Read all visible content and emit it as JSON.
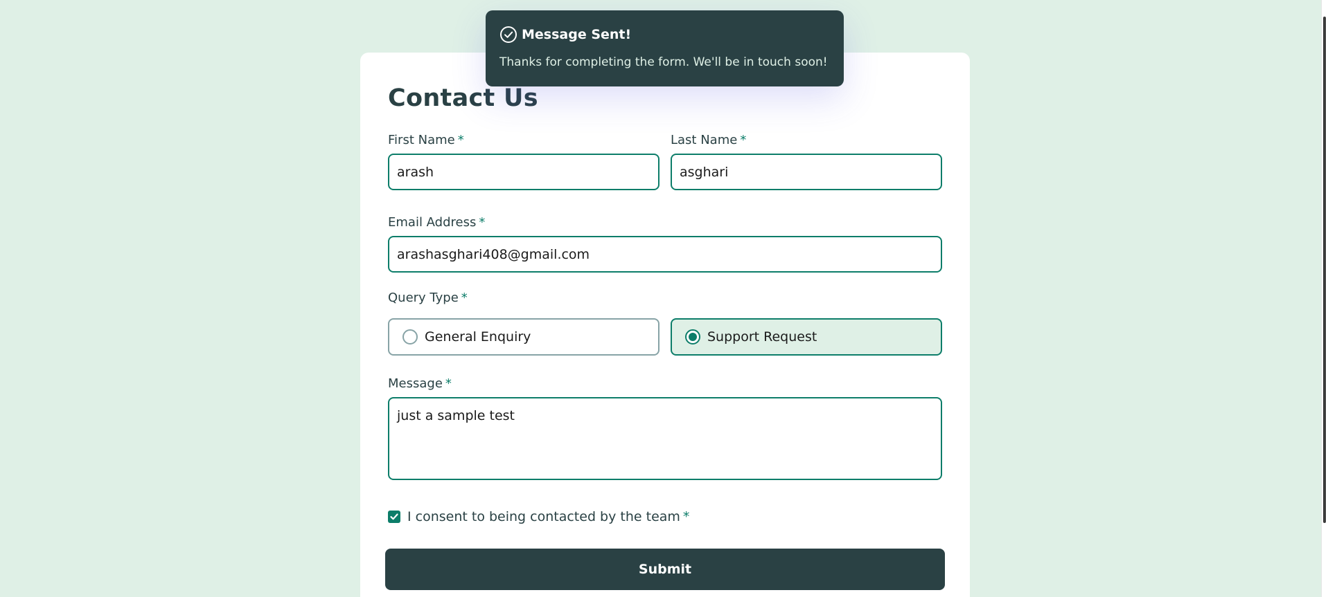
{
  "form": {
    "title": "Contact Us",
    "required_marker": "*",
    "first_name": {
      "label": "First Name",
      "value": "arash"
    },
    "last_name": {
      "label": "Last Name",
      "value": "asghari"
    },
    "email": {
      "label": "Email Address",
      "value": "arashasghari408@gmail.com"
    },
    "query_type": {
      "label": "Query Type",
      "options": [
        {
          "label": "General Enquiry",
          "selected": false
        },
        {
          "label": "Support Request",
          "selected": true
        }
      ]
    },
    "message": {
      "label": "Message",
      "value": "just a sample test"
    },
    "consent": {
      "label": "I consent to being contacted by the team",
      "checked": true
    },
    "submit_label": "Submit"
  },
  "toast": {
    "title": "Message Sent!",
    "message": "Thanks for completing the form. We'll be in touch soon!",
    "icon": "check-circle-icon"
  },
  "colors": {
    "page_background": "#dff0e6",
    "accent": "#0c7d69",
    "dark": "#2a4144",
    "card": "#ffffff",
    "unselected_border": "#87a3a6"
  }
}
